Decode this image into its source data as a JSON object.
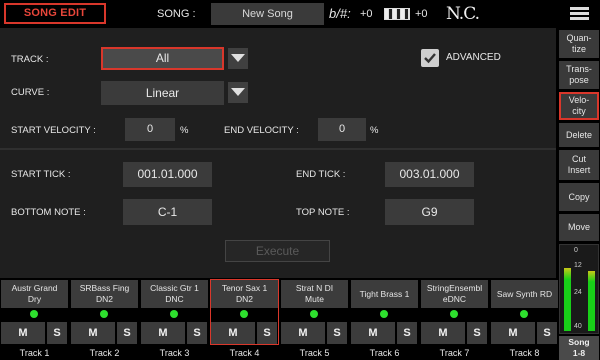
{
  "header": {
    "mode_label": "SONG EDIT",
    "song_label": "SONG :",
    "song_name": "New Song",
    "transpose_label": "b/#:",
    "transpose_value": "+0",
    "keyboard_value": "+0",
    "chord": "N.C.",
    "menu_icon": "hamburger-menu-icon"
  },
  "form": {
    "track_label": "TRACK :",
    "track_value": "All",
    "curve_label": "CURVE :",
    "curve_value": "Linear",
    "advanced_label": "ADVANCED",
    "advanced_checked": true,
    "start_velocity_label": "START VELOCITY :",
    "start_velocity_value": "0",
    "end_velocity_label": "END VELOCITY :",
    "end_velocity_value": "0",
    "percent_unit": "%",
    "start_tick_label": "START TICK :",
    "start_tick_value": "001.01.000",
    "end_tick_label": "END TICK :",
    "end_tick_value": "003.01.000",
    "bottom_note_label": "BOTTOM NOTE :",
    "bottom_note_value": "C-1",
    "top_note_label": "TOP NOTE :",
    "top_note_value": "G9",
    "execute_label": "Execute"
  },
  "sidebar": {
    "buttons": [
      {
        "label": "Quan-\ntize"
      },
      {
        "label": "Trans-\npose"
      },
      {
        "label": "Velo-\ncity"
      },
      {
        "label": "Delete"
      },
      {
        "label": "Cut\nInsert"
      },
      {
        "label": "Copy"
      },
      {
        "label": "Move"
      }
    ],
    "meter_ticks": [
      "0",
      "12",
      "24",
      "40"
    ],
    "meter_levels": [
      0.75,
      0.72
    ],
    "song_button": "Song\n1-8"
  },
  "tracks": [
    {
      "name": "Austr Grand\nDry",
      "mute": "M",
      "solo": "S",
      "label": "Track 1"
    },
    {
      "name": "SRBass Fing\nDN2",
      "mute": "M",
      "solo": "S",
      "label": "Track 2"
    },
    {
      "name": "Classic Gtr 1\nDNC",
      "mute": "M",
      "solo": "S",
      "label": "Track 3"
    },
    {
      "name": "Tenor Sax 1\nDN2",
      "mute": "M",
      "solo": "S",
      "label": "Track 4"
    },
    {
      "name": "Strat N DI\nMute",
      "mute": "M",
      "solo": "S",
      "label": "Track 5"
    },
    {
      "name": "Tight Brass 1",
      "mute": "M",
      "solo": "S",
      "label": "Track 6"
    },
    {
      "name": "StringEnsembl\neDNC",
      "mute": "M",
      "solo": "S",
      "label": "Track 7"
    },
    {
      "name": "Saw Synth RD",
      "mute": "M",
      "solo": "S",
      "label": "Track 8"
    }
  ],
  "colors": {
    "accent": "#d9372b",
    "led": "#2ee02e"
  }
}
